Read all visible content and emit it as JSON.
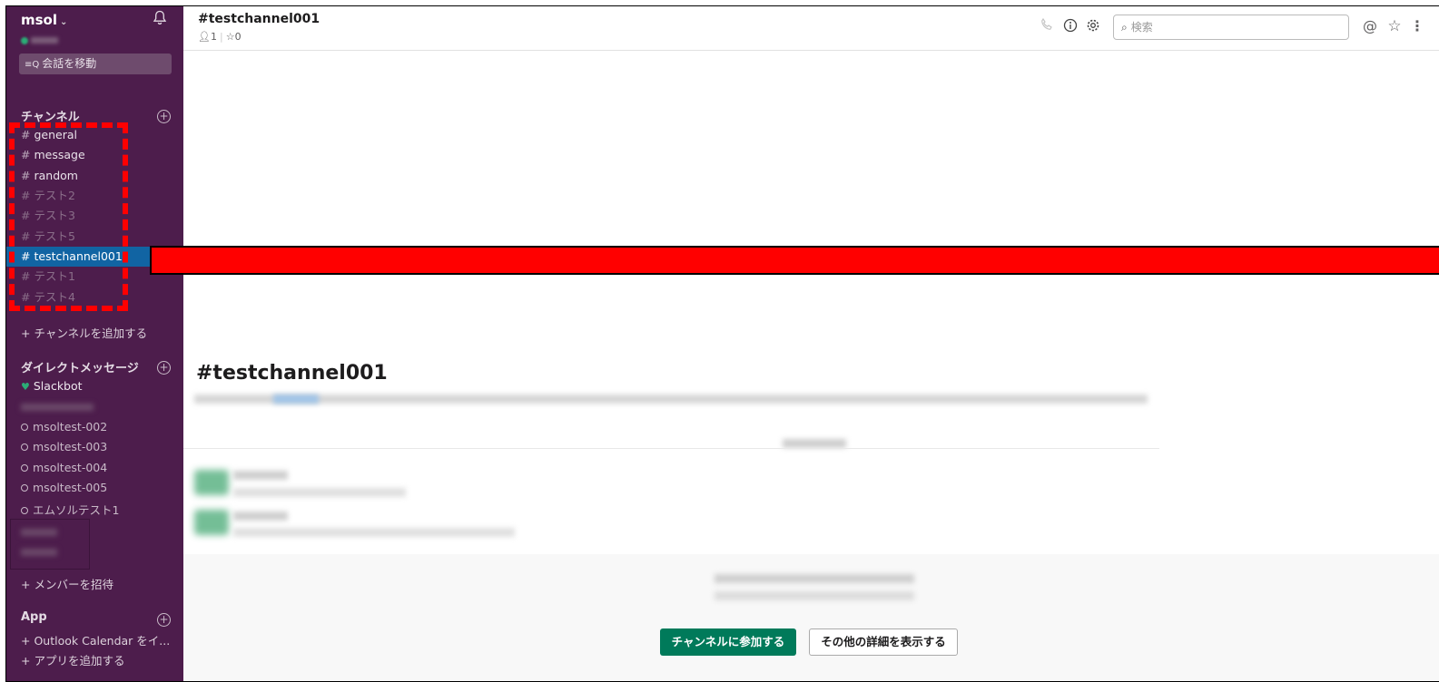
{
  "team": {
    "name": "msol",
    "caret": "⌄"
  },
  "jump": {
    "icon": "≡Q",
    "label": "会話を移動"
  },
  "channels": {
    "title": "チャンネル",
    "add_icon": "+",
    "items": [
      {
        "label": "general",
        "state": "normal"
      },
      {
        "label": "message",
        "state": "normal"
      },
      {
        "label": "random",
        "state": "normal"
      },
      {
        "label": "テスト2",
        "state": "muted"
      },
      {
        "label": "テスト3",
        "state": "muted"
      },
      {
        "label": "テスト5",
        "state": "muted"
      },
      {
        "label": "testchannel001",
        "state": "active"
      },
      {
        "label": "テスト1",
        "state": "muted"
      },
      {
        "label": "テスト4",
        "state": "muted"
      }
    ],
    "hash": "#",
    "add_link": "+ チャンネルを追加する"
  },
  "dms": {
    "title": "ダイレクトメッセージ",
    "items": [
      "Slackbot",
      "msoltest-002",
      "msoltest-003",
      "msoltest-004",
      "msoltest-005",
      "エムソルテスト1"
    ],
    "invite": "+ メンバーを招待"
  },
  "apps": {
    "title": "App",
    "outlook": "+ Outlook Calendar をイ...",
    "add": "+ アプリを追加する"
  },
  "header": {
    "title": "#testchannel001",
    "members": "1",
    "pins": "0",
    "search_placeholder": "検索"
  },
  "main": {
    "channel_heading": "#testchannel001",
    "join_button": "チャンネルに参加する",
    "details_button": "その他の詳細を表示する"
  },
  "colors": {
    "sidebar": "#4d1d4c",
    "active_channel": "#1164a3",
    "join_button": "#007a5a",
    "annotation": "#ff0000"
  }
}
